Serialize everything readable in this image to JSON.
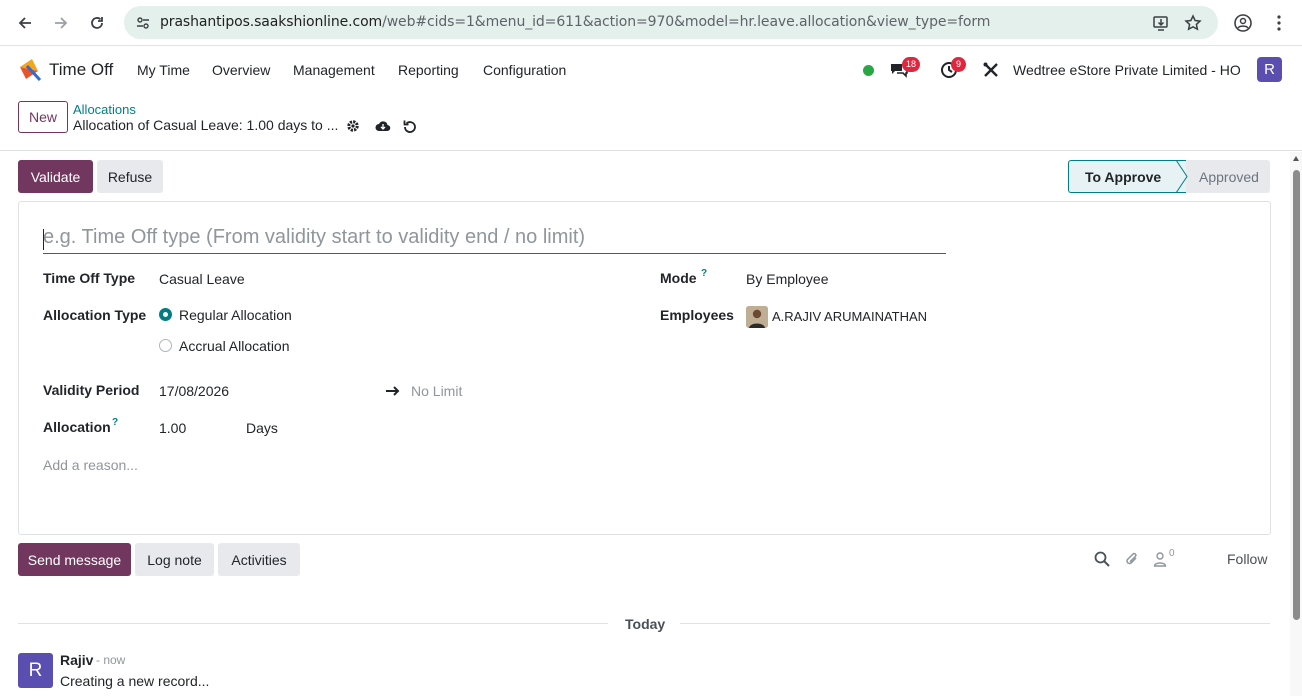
{
  "browser": {
    "url_host": "prashantipos.saakshionline.com",
    "url_path": "/web#cids=1&menu_id=611&action=970&model=hr.leave.allocation&view_type=form"
  },
  "navbar": {
    "app_name": "Time Off",
    "menu": [
      "My Time",
      "Overview",
      "Management",
      "Reporting",
      "Configuration"
    ],
    "messages_count": "18",
    "activities_count": "9",
    "company": "Wedtree eStore Private Limited - HO",
    "user_initial": "R",
    "presence_color": "#28a745"
  },
  "control_panel": {
    "new_label": "New",
    "breadcrumb_parent": "Allocations",
    "breadcrumb_current": "Allocation of Casual Leave: 1.00 days to ..."
  },
  "actions": {
    "validate": "Validate",
    "refuse": "Refuse"
  },
  "status": {
    "current": "To Approve",
    "next": "Approved"
  },
  "form": {
    "name_placeholder": "e.g. Time Off type (From validity start to validity end / no limit)",
    "time_off_type_label": "Time Off Type",
    "time_off_type_value": "Casual Leave",
    "allocation_type_label": "Allocation Type",
    "allocation_type_options": [
      "Regular Allocation",
      "Accrual Allocation"
    ],
    "allocation_type_selected": "Regular Allocation",
    "validity_label": "Validity Period",
    "validity_start": "17/08/2026",
    "validity_end": "No Limit",
    "allocation_label": "Allocation",
    "allocation_value": "1.00",
    "allocation_unit": "Days",
    "reason_placeholder": "Add a reason...",
    "mode_label": "Mode",
    "mode_value": "By Employee",
    "employees_label": "Employees",
    "employee_name": "A.RAJIV ARUMAINATHAN",
    "help_mark": "?"
  },
  "chatter": {
    "send_message": "Send message",
    "log_note": "Log note",
    "activities": "Activities",
    "followers_count": "0",
    "follow": "Follow",
    "date_separator": "Today",
    "message": {
      "author_initial": "R",
      "author": "Rajiv",
      "time": "- now",
      "body": "Creating a new record..."
    }
  },
  "colors": {
    "primary": "#71375e",
    "accent": "#017e84",
    "badge": "#e0263f"
  }
}
